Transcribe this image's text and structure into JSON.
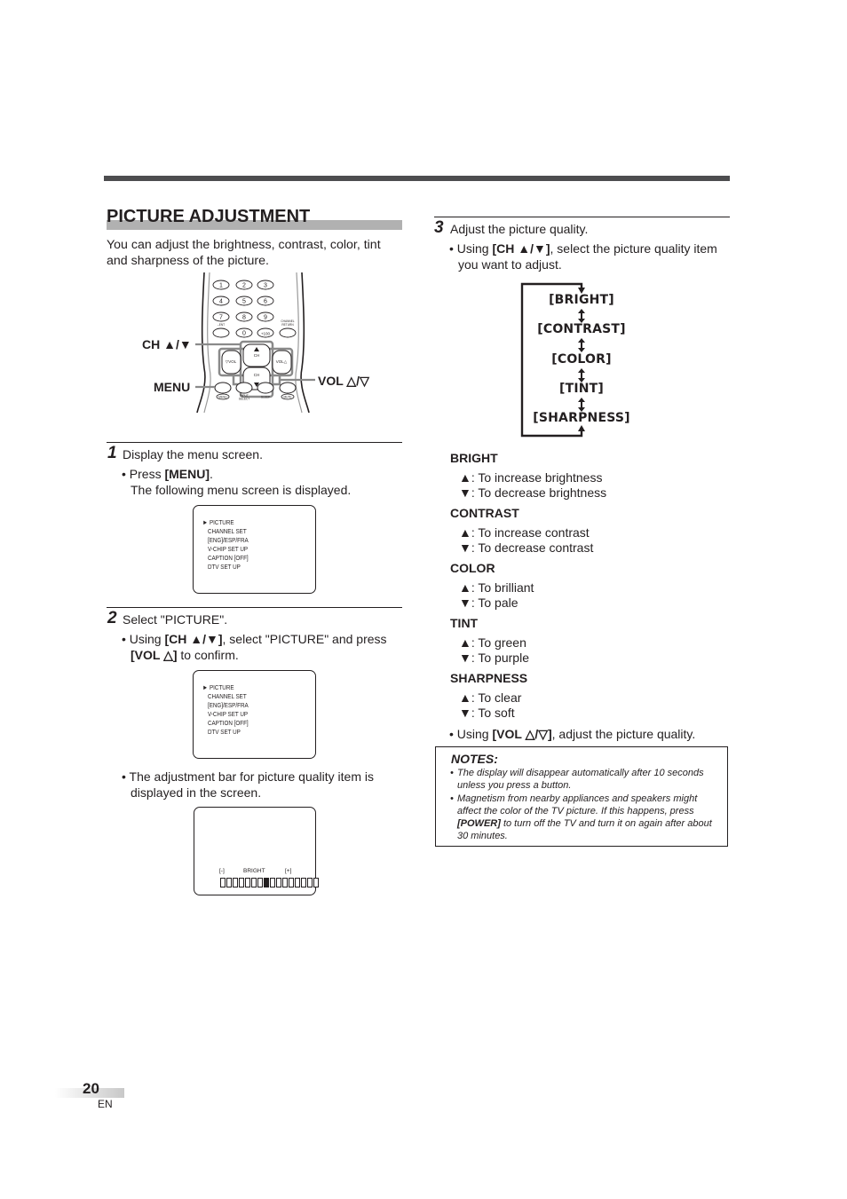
{
  "page": {
    "title": "PICTURE ADJUSTMENT",
    "intro": "You can adjust the brightness, contrast, color, tint and sharpness of the picture.",
    "page_number": "20",
    "language": "EN"
  },
  "remote": {
    "callouts": {
      "ch": "CH ▲/▼",
      "menu": "MENU",
      "vol": "VOL △/▽"
    },
    "number_keys": [
      "1",
      "2",
      "3",
      "4",
      "5",
      "6",
      "7",
      "8",
      "9",
      "0",
      "+100"
    ],
    "small_labels": {
      "ent": "–ENT",
      "channel_return": "CHANNEL RETURN",
      "ch_up": "CH",
      "ch_down": "CH",
      "vol_down": "▽VOL",
      "vol_up": "VOL△",
      "menu": "MENU",
      "input_select": "INPUT SELECT",
      "sleep": "SLEEP",
      "mute": "MUTE"
    }
  },
  "steps": [
    {
      "number": "1",
      "heading": "Display the menu screen.",
      "bullet_prefix": "• Press ",
      "bullet_bold": "[MENU]",
      "bullet_suffix": ".",
      "followup": "The following menu screen is displayed."
    },
    {
      "number": "2",
      "heading": "Select \"PICTURE\".",
      "bullet_prefix": "• Using ",
      "bullet_bold": "[CH ▲/▼]",
      "bullet_suffix": ", select \"PICTURE\" and press",
      "line2_bold": "[VOL △]",
      "line2_suffix": " to confirm.",
      "note": "• The adjustment bar for picture quality item is",
      "note_line2": "displayed in the screen."
    },
    {
      "number": "3",
      "heading": "Adjust the picture quality.",
      "bullet_prefix": "• Using ",
      "bullet_bold": "[CH ▲/▼]",
      "bullet_suffix": ", select the picture quality item",
      "line2": "you want to adjust."
    }
  ],
  "tv_menu": {
    "cursor": "►",
    "items": [
      "PICTURE",
      "CHANNEL SET",
      "[ENG]/ESP/FRA",
      "V-CHIP SET UP",
      "CAPTION [OFF]",
      "DTV SET UP"
    ],
    "selected_index": 0
  },
  "adjust_bar": {
    "minus": "[-]",
    "label": "BRIGHT",
    "plus": "[+]",
    "segments": 16,
    "level_index": 7
  },
  "flow": [
    "[BRIGHT]",
    "[CONTRAST]",
    "[COLOR]",
    "[TINT]",
    "[SHARPNESS]"
  ],
  "settings": [
    {
      "name": "BRIGHT",
      "up": "▲: To increase brightness",
      "down": "▼: To decrease brightness"
    },
    {
      "name": "CONTRAST",
      "up": "▲: To increase contrast",
      "down": "▼: To decrease contrast"
    },
    {
      "name": "COLOR",
      "up": "▲: To brilliant",
      "down": "▼: To pale"
    },
    {
      "name": "TINT",
      "up": "▲: To green",
      "down": "▼: To purple"
    },
    {
      "name": "SHARPNESS",
      "up": "▲: To clear",
      "down": "▼: To soft"
    }
  ],
  "adjust_instruction": {
    "prefix": "• Using ",
    "bold": "[VOL △/▽]",
    "suffix": ", adjust the picture quality."
  },
  "notes": {
    "title": "NOTES:",
    "items": [
      {
        "text": "The display will disappear automatically after 10 seconds unless you press a button."
      },
      {
        "text_before": "Magnetism from nearby appliances and speakers might affect the color of the TV picture. If this happens, press ",
        "bold": "[POWER]",
        "text_after": " to turn off the TV and turn it on again after about 30 minutes."
      }
    ]
  }
}
